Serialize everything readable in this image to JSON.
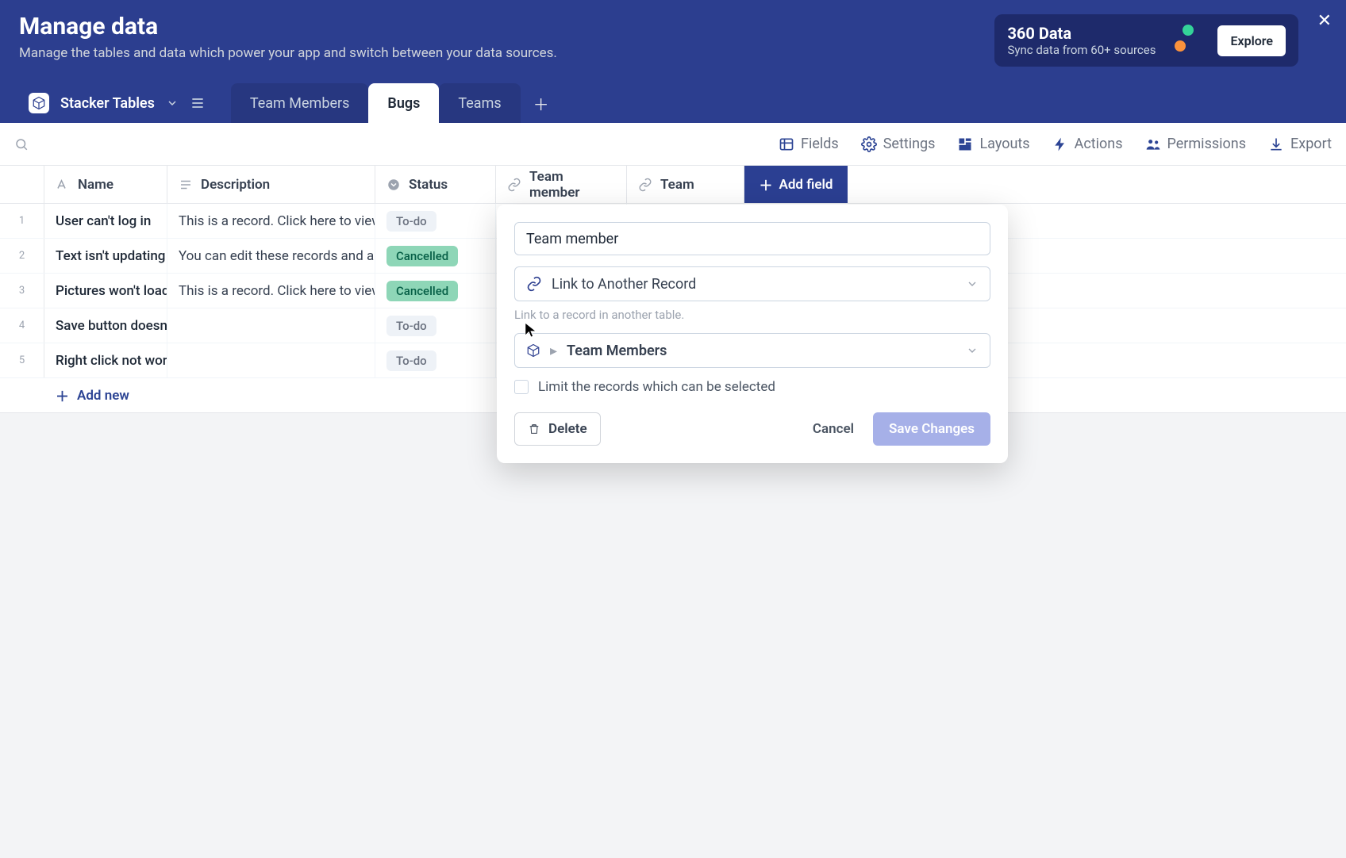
{
  "header": {
    "title": "Manage data",
    "subtitle": "Manage the tables and data which power your app and switch between your data sources."
  },
  "promo": {
    "title": "360 Data",
    "subtitle": "Sync data from 60+ sources",
    "cta": "Explore"
  },
  "datasource": {
    "name": "Stacker Tables"
  },
  "tabs": [
    {
      "label": "Team Members",
      "active": false
    },
    {
      "label": "Bugs",
      "active": true
    },
    {
      "label": "Teams",
      "active": false
    }
  ],
  "toolbar": {
    "fields": "Fields",
    "settings": "Settings",
    "layouts": "Layouts",
    "actions": "Actions",
    "permissions": "Permissions",
    "export": "Export"
  },
  "columns": {
    "name": "Name",
    "description": "Description",
    "status": "Status",
    "team_member": "Team member",
    "team": "Team",
    "add_field": "Add field"
  },
  "status_labels": {
    "todo": "To-do",
    "cancelled": "Cancelled"
  },
  "rows": [
    {
      "n": "1",
      "name": "User can't log in",
      "desc": "This is a record. Click here to view",
      "status": "todo"
    },
    {
      "n": "2",
      "name": "Text isn't updating",
      "desc": "You can edit these records and ac",
      "status": "cancelled"
    },
    {
      "n": "3",
      "name": "Pictures won't load",
      "desc": "This is a record. Click here to view",
      "status": "cancelled"
    },
    {
      "n": "4",
      "name": "Save button doesn'",
      "desc": "",
      "status": "todo"
    },
    {
      "n": "5",
      "name": "Right click not work",
      "desc": "",
      "status": "todo"
    }
  ],
  "add_new": "Add new",
  "popover": {
    "field_name": "Team member",
    "type_label": "Link to Another Record",
    "type_help": "Link to a record in another table.",
    "linked_table": "Team Members",
    "limit_label": "Limit the records which can be selected",
    "delete": "Delete",
    "cancel": "Cancel",
    "save": "Save Changes"
  }
}
